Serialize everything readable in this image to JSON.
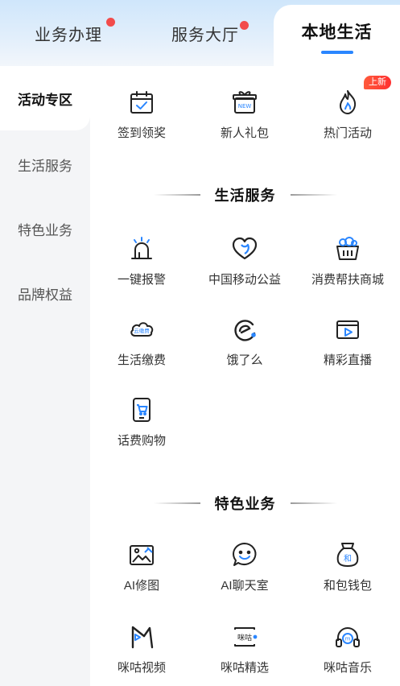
{
  "tabs": [
    {
      "label": "业务办理",
      "has_dot": true
    },
    {
      "label": "服务大厅",
      "has_dot": true
    },
    {
      "label": "本地生活",
      "active": true
    }
  ],
  "sidebar": {
    "items": [
      {
        "label": "活动专区",
        "active": true
      },
      {
        "label": "生活服务"
      },
      {
        "label": "特色业务"
      },
      {
        "label": "品牌权益"
      }
    ]
  },
  "activity": {
    "items": [
      {
        "label": "签到领奖",
        "icon": "calendar-check-icon"
      },
      {
        "label": "新人礼包",
        "icon": "gift-new-icon"
      },
      {
        "label": "热门活动",
        "icon": "flame-icon",
        "badge": "上新"
      }
    ]
  },
  "life_services": {
    "title": "生活服务",
    "items": [
      {
        "label": "一键报警",
        "icon": "alarm-siren-icon"
      },
      {
        "label": "中国移动公益",
        "icon": "heart-charity-icon"
      },
      {
        "label": "消费帮扶商城",
        "icon": "shopping-basket-icon"
      },
      {
        "label": "生活缴费",
        "icon": "cloud-payment-icon",
        "icon_text": "云缴费"
      },
      {
        "label": "饿了么",
        "icon": "eleme-logo-icon"
      },
      {
        "label": "精彩直播",
        "icon": "live-video-icon"
      },
      {
        "label": "话费购物",
        "icon": "phone-cart-icon"
      }
    ]
  },
  "featured": {
    "title": "特色业务",
    "items": [
      {
        "label": "AI修图",
        "icon": "image-edit-icon"
      },
      {
        "label": "AI聊天室",
        "icon": "chat-smile-icon"
      },
      {
        "label": "和包钱包",
        "icon": "money-bag-icon",
        "icon_text": "和"
      },
      {
        "label": "咪咕视频",
        "icon": "migu-video-icon"
      },
      {
        "label": "咪咕精选",
        "icon": "migu-select-icon",
        "icon_text": "咪咕"
      },
      {
        "label": "咪咕音乐",
        "icon": "headphones-icon",
        "icon_text": "m"
      }
    ]
  },
  "colors": {
    "accent": "#2a86ff",
    "badge": "#ff3b30",
    "dot": "#f24b4b"
  }
}
